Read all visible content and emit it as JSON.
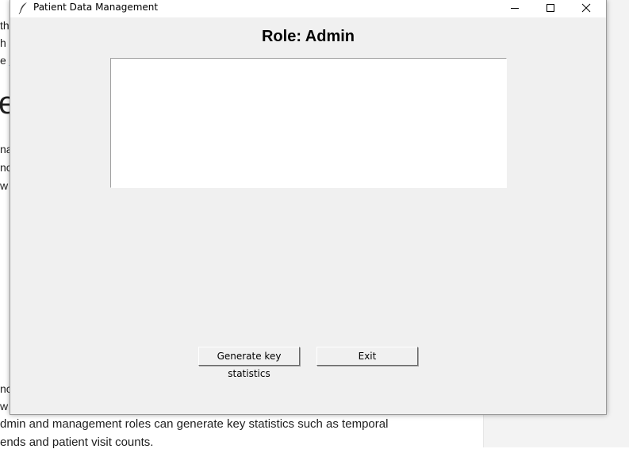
{
  "background_document": {
    "fragments": [
      "th",
      "h",
      "e",
      "e",
      "na",
      "nc",
      "w",
      "nc",
      "w"
    ],
    "line_1": "dmin and management roles can generate key statistics such as temporal",
    "line_2": "ends and patient visit counts."
  },
  "window": {
    "title": "Patient Data Management",
    "controls": {
      "minimize": "minimize-icon",
      "maximize": "maximize-icon",
      "close": "close-icon"
    }
  },
  "main": {
    "role_label": "Role: Admin",
    "text_area_value": ""
  },
  "buttons": {
    "generate_label": "Generate key statistics",
    "exit_label": "Exit"
  }
}
